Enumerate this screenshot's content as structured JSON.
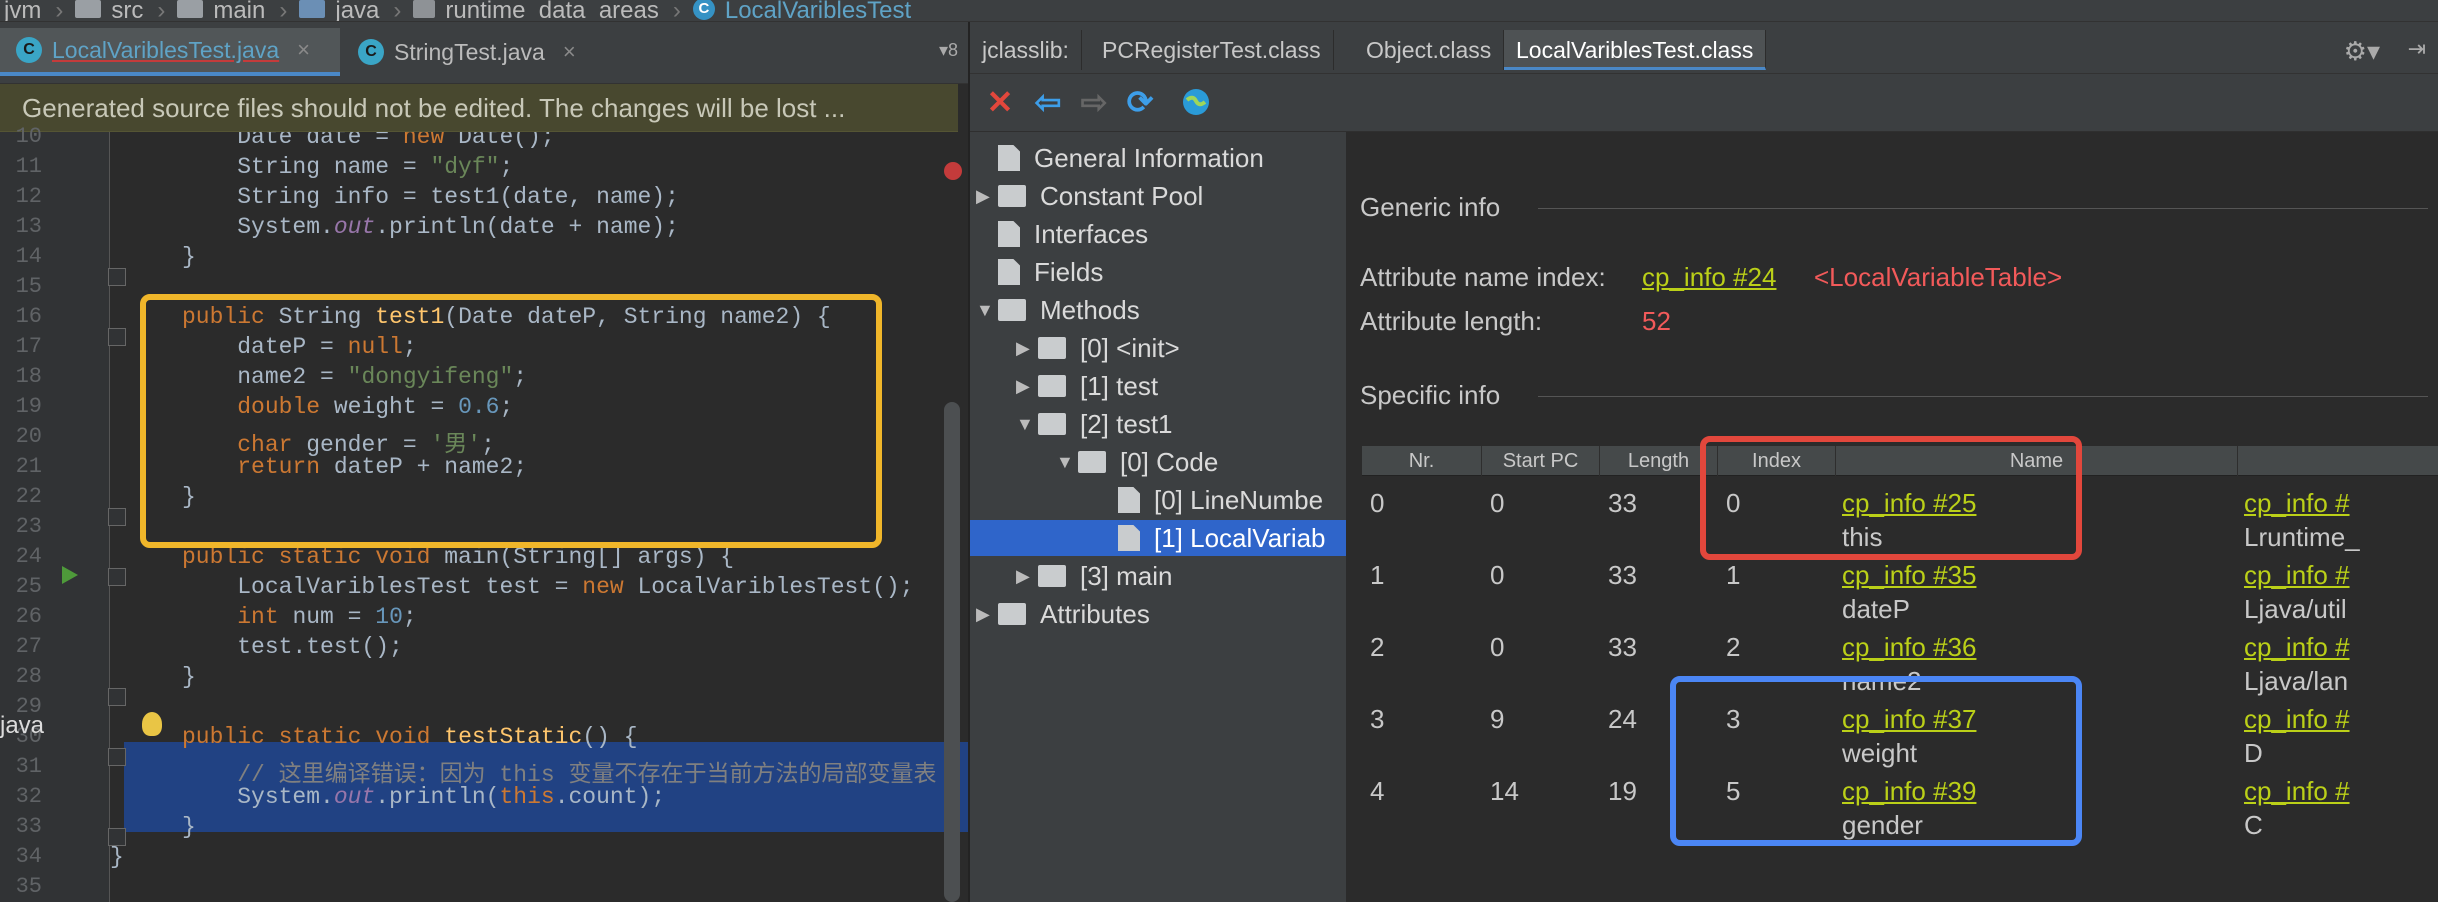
{
  "breadcrumb": [
    {
      "label": "jvm",
      "icon": "folder-icon"
    },
    {
      "label": "src",
      "icon": "folder-icon"
    },
    {
      "label": "main",
      "icon": "folder-icon"
    },
    {
      "label": "java",
      "icon": "source-folder-icon"
    },
    {
      "label": "runtime_data_areas",
      "icon": "package-icon"
    },
    {
      "label": "LocalVariblesTest",
      "icon": "class-icon"
    }
  ],
  "editor": {
    "tabs": [
      {
        "label": "LocalVariblesTest.java",
        "close": "×",
        "active": true
      },
      {
        "label": "StringTest.java",
        "close": "×",
        "active": false
      }
    ],
    "tab_overflow": "▾8",
    "banner": "Generated source files should not be edited. The changes will be lost ...",
    "gutter_label": "java",
    "line_numbers": [
      "10",
      "11",
      "12",
      "13",
      "14",
      "15",
      "16",
      "17",
      "18",
      "19",
      "20",
      "21",
      "22",
      "23",
      "24",
      "25",
      "26",
      "27",
      "28",
      "29",
      "30",
      "31",
      "32",
      "33",
      "34",
      "35"
    ]
  },
  "jclasslib": {
    "tabs": [
      "jclasslib:",
      "PCRegisterTest.class",
      "Object.class",
      "LocalVariblesTest.class"
    ],
    "active_tab": "LocalVariblesTest.class",
    "tree": [
      {
        "label": "General Information"
      },
      {
        "label": "Constant Pool"
      },
      {
        "label": "Interfaces"
      },
      {
        "label": "Fields"
      },
      {
        "label": "Methods"
      },
      {
        "label": "[0] <init>"
      },
      {
        "label": "[1] test"
      },
      {
        "label": "[2] test1"
      },
      {
        "label": "[0] Code"
      },
      {
        "label": "[0] LineNumbe"
      },
      {
        "label": "[1] LocalVariab"
      },
      {
        "label": "[3] main"
      },
      {
        "label": "Attributes"
      }
    ],
    "generic_info": {
      "title": "Generic info",
      "name_index_label": "Attribute name index:",
      "name_index_link": "cp_info #24",
      "name_index_value": "<LocalVariableTable>",
      "length_label": "Attribute length:",
      "length_value": "52"
    },
    "specific_info": {
      "title": "Specific info",
      "columns": [
        "Nr.",
        "Start PC",
        "Length",
        "Index",
        "Name"
      ],
      "rows": [
        {
          "nr": "0",
          "start_pc": "0",
          "length": "33",
          "index": "0",
          "name_link": "cp_info #25",
          "name": "this",
          "desc_link": "cp_info #",
          "desc": "Lruntime_"
        },
        {
          "nr": "1",
          "start_pc": "0",
          "length": "33",
          "index": "1",
          "name_link": "cp_info #35",
          "name": "dateP",
          "desc_link": "cp_info #",
          "desc": "Ljava/util"
        },
        {
          "nr": "2",
          "start_pc": "0",
          "length": "33",
          "index": "2",
          "name_link": "cp_info #36",
          "name": "name2",
          "desc_link": "cp_info #",
          "desc": "Ljava/lan"
        },
        {
          "nr": "3",
          "start_pc": "9",
          "length": "24",
          "index": "3",
          "name_link": "cp_info #37",
          "name": "weight",
          "desc_link": "cp_info #",
          "desc": "D"
        },
        {
          "nr": "4",
          "start_pc": "14",
          "length": "19",
          "index": "5",
          "name_link": "cp_info #39",
          "name": "gender",
          "desc_link": "cp_info #",
          "desc": "C"
        }
      ]
    }
  }
}
